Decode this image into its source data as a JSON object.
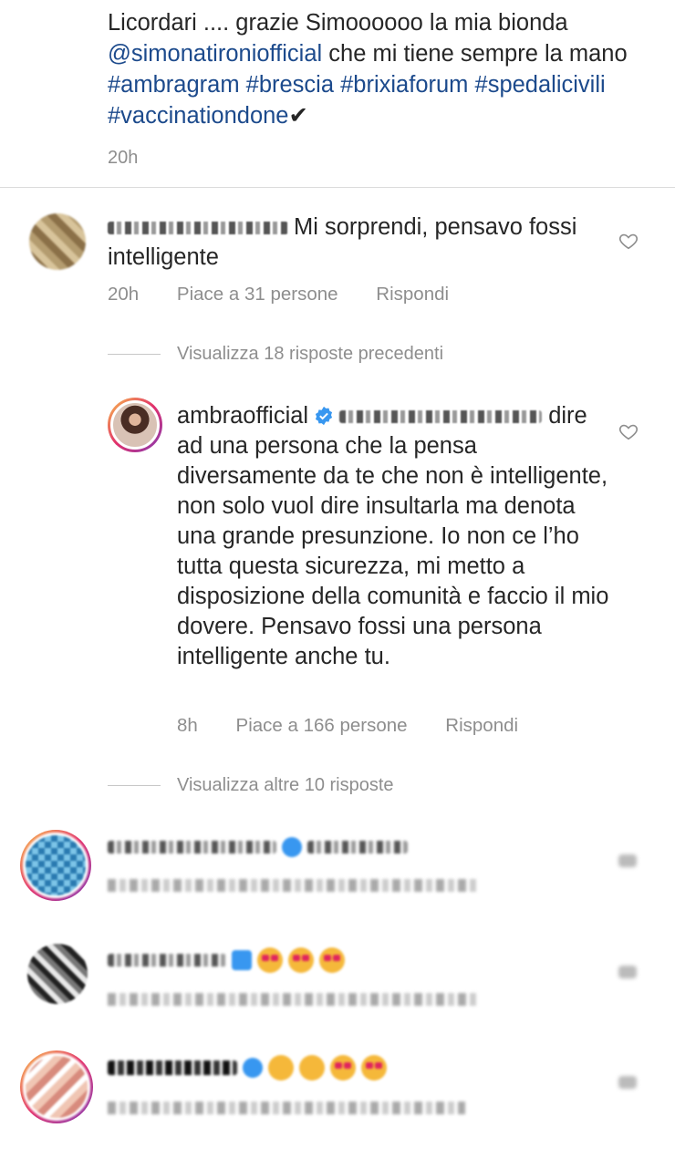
{
  "caption": {
    "text_start": "Licordari .... grazie Simoooooo la mia bionda ",
    "mention": "@simonatironiofficial",
    "text_mid": "  che mi tiene sempre la mano ",
    "hashtags_line1": "#ambragram #brescia #brixiaforum",
    "hashtags_line2": "#spedalicivili  #vaccinationdone",
    "checkmark": "✔",
    "time": "20h"
  },
  "comment1": {
    "text": "Mi sorprendi, pensavo fossi intelligente",
    "time": "20h",
    "likes": "Piace a 31 persone",
    "reply": "Rispondi"
  },
  "view_previous": "Visualizza 18 risposte precedenti",
  "comment2": {
    "username": "ambraofficial",
    "text": "dire ad una persona che la pensa diversamente da te che non è intelligente, non solo vuol dire insultarla ma denota una grande presunzione. Io non ce l’ho tutta questa sicurezza, mi metto a disposizione della comunità e faccio il mio dovere. Pensavo fossi una persona intelligente anche tu.",
    "time": "8h",
    "likes": "Piace a 166 persone",
    "reply": "Rispondi"
  },
  "view_more": "Visualizza altre 10 risposte",
  "colors": {
    "link": "#1c4a8c",
    "muted": "#8e8e8e",
    "verified": "#3897f0",
    "text": "#262626"
  },
  "icons": [
    "heart-outline-icon",
    "verified-badge-icon"
  ]
}
